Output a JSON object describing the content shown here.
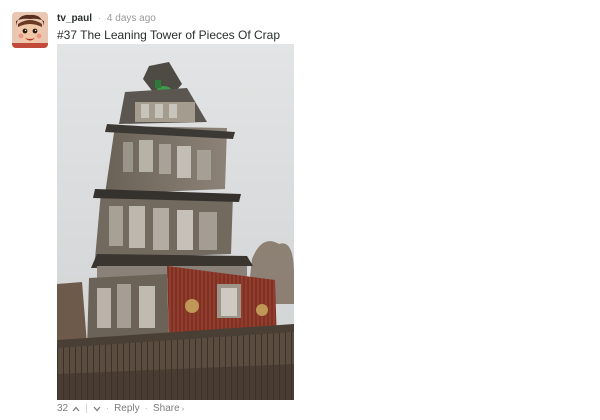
{
  "comment": {
    "author": "tv_paul",
    "separator": "·",
    "timestamp": "4 days ago",
    "title": "#37 The Leaning Tower of Pieces Of Crap",
    "avatar_icon": "cartoon-face-avatar",
    "image_subject": "leaning-wooden-tower-photo"
  },
  "footer": {
    "votes": "32",
    "upvote_icon": "chevron-up-icon",
    "divider": "|",
    "downvote_icon": "chevron-down-icon",
    "dot": "·",
    "reply_label": "Reply",
    "share_label": "Share",
    "share_caret": "›"
  },
  "colors": {
    "username": "#2a2e2e",
    "meta": "#9a9a9a",
    "sky": "#d9dadb",
    "siding_red": "#8c3a2b"
  }
}
